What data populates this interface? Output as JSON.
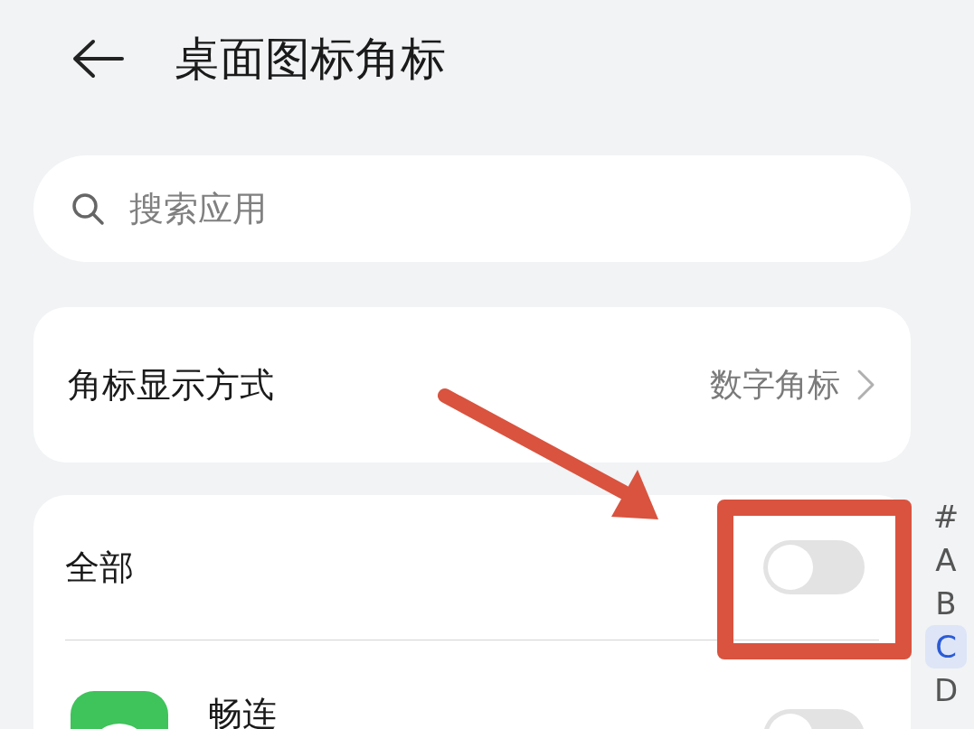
{
  "header": {
    "title": "桌面图标角标"
  },
  "search": {
    "placeholder": "搜索应用"
  },
  "badge_style": {
    "label": "角标显示方式",
    "value": "数字角标"
  },
  "rows": [
    {
      "kind": "all",
      "name": "全部",
      "on": false
    },
    {
      "kind": "app",
      "name": "畅连",
      "on": false
    }
  ],
  "index": [
    {
      "label": "#",
      "selected": false
    },
    {
      "label": "A",
      "selected": false
    },
    {
      "label": "B",
      "selected": false
    },
    {
      "label": "C",
      "selected": true
    },
    {
      "label": "D",
      "selected": false
    }
  ]
}
